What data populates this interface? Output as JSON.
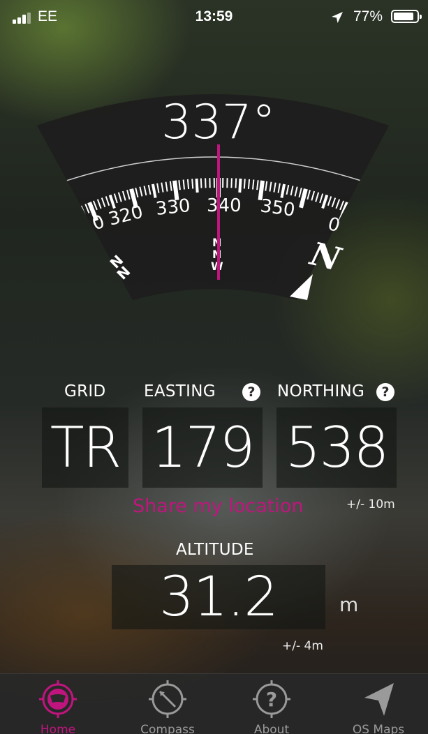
{
  "status_bar": {
    "carrier": "EE",
    "time": "13:59",
    "battery_percent": "77%",
    "battery_level": 0.77,
    "icons": [
      "signal-bars-icon",
      "location-arrow-icon",
      "battery-icon"
    ]
  },
  "compass": {
    "heading": "337°",
    "scale_labels": [
      "0",
      "320",
      "330",
      "340",
      "350",
      "0"
    ],
    "direction_labels": [
      "N",
      "N",
      "N",
      "N",
      "W",
      "N"
    ],
    "needle_color": "#c0157e"
  },
  "grid_reference": {
    "grid_label": "GRID",
    "easting_label": "EASTING",
    "northing_label": "NORTHING",
    "grid_value": "TR",
    "easting_value": "179",
    "northing_value": "538",
    "accuracy": "+/- 10m",
    "help_glyph": "?"
  },
  "share": {
    "label": "Share my location"
  },
  "altitude": {
    "label": "ALTITUDE",
    "value": "31.2",
    "unit": "m",
    "accuracy": "+/- 4m"
  },
  "tabs": [
    {
      "label": "Home",
      "icon": "home-compass-icon",
      "active": true
    },
    {
      "label": "Compass",
      "icon": "compass-icon",
      "active": false
    },
    {
      "label": "About",
      "icon": "about-question-icon",
      "active": false
    },
    {
      "label": "OS Maps",
      "icon": "os-maps-arrow-icon",
      "active": false
    }
  ],
  "colors": {
    "accent": "#c0157e",
    "tab_inactive": "#9a9a9a"
  }
}
